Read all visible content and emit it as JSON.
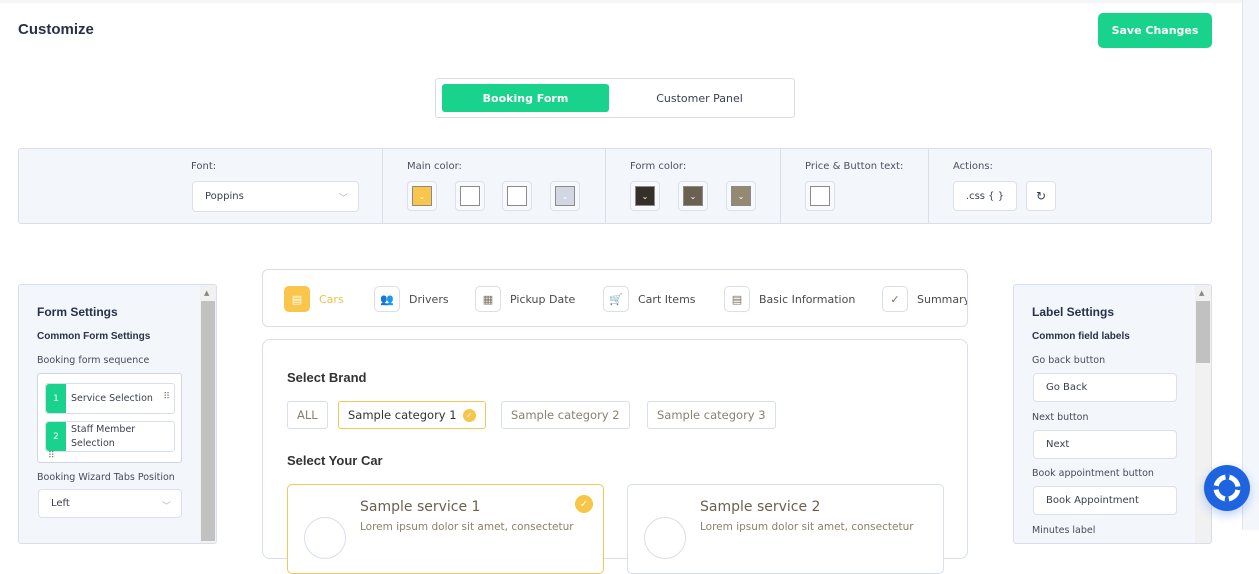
{
  "header": {
    "title": "Customize",
    "save_label": "Save Changes"
  },
  "mode_tabs": [
    {
      "label": "Booking Form",
      "active": true
    },
    {
      "label": "Customer Panel",
      "active": false
    }
  ],
  "toolbar": {
    "font_label": "Font:",
    "font_value": "Poppins",
    "main_color_label": "Main color:",
    "main_colors": [
      "#f9c54a",
      "#ffffff",
      "#ffffff",
      "#d3d7e3"
    ],
    "form_color_label": "Form color:",
    "form_colors": [
      "#35302a",
      "#6b6150",
      "#948a72"
    ],
    "price_label": "Price & Button text:",
    "price_color": "#ffffff",
    "actions_label": "Actions:",
    "css_label": ".css { }",
    "reset_icon": "↻"
  },
  "form_settings": {
    "title": "Form Settings",
    "subtitle": "Common Form Settings",
    "sequence_label": "Booking form sequence",
    "sequence": [
      {
        "num": "1",
        "label": "Service Selection"
      },
      {
        "num": "2",
        "label": "Staff Member Selection"
      }
    ],
    "tabs_position_label": "Booking Wizard Tabs Position",
    "tabs_position_value": "Left"
  },
  "steps": [
    {
      "label": "Cars",
      "icon": "▤",
      "active": true
    },
    {
      "label": "Drivers",
      "icon": "👥",
      "active": false
    },
    {
      "label": "Pickup Date",
      "icon": "▦",
      "active": false
    },
    {
      "label": "Cart Items",
      "icon": "🛒",
      "active": false
    },
    {
      "label": "Basic Information",
      "icon": "▤",
      "active": false
    },
    {
      "label": "Summary",
      "icon": "✓",
      "active": false
    }
  ],
  "brand": {
    "title": "Select Brand",
    "chips": [
      {
        "label": "ALL",
        "selected": false
      },
      {
        "label": "Sample category 1",
        "selected": true
      },
      {
        "label": "Sample category 2",
        "selected": false
      },
      {
        "label": "Sample category 3",
        "selected": false
      }
    ]
  },
  "car": {
    "title": "Select Your Car",
    "services": [
      {
        "title": "Sample service 1",
        "desc": "Lorem ipsum dolor sit amet, consectetur",
        "selected": true
      },
      {
        "title": "Sample service 2",
        "desc": "Lorem ipsum dolor sit amet, consectetur",
        "selected": false
      }
    ]
  },
  "label_settings": {
    "title": "Label Settings",
    "subtitle": "Common field labels",
    "fields": [
      {
        "label": "Go back button",
        "value": "Go Back"
      },
      {
        "label": "Next button",
        "value": "Next"
      },
      {
        "label": "Book appointment button",
        "value": "Book Appointment"
      },
      {
        "label": "Minutes label",
        "value": ""
      }
    ]
  }
}
